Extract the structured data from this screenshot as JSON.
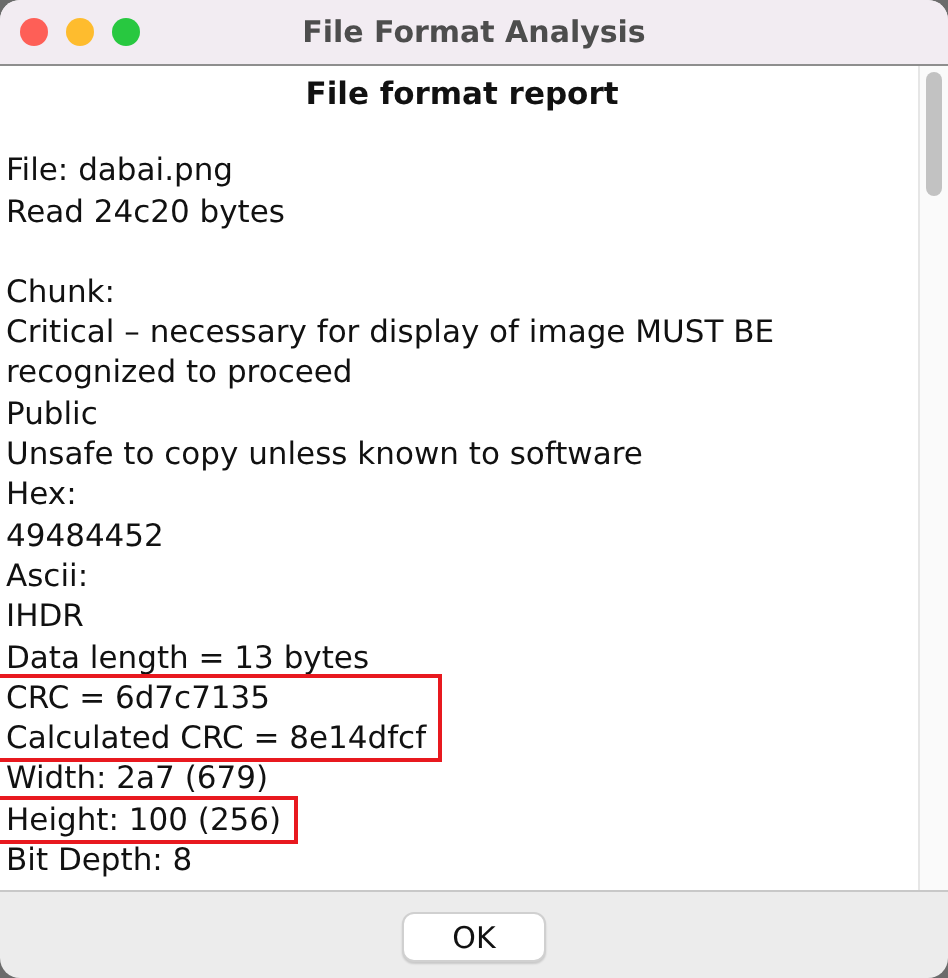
{
  "window": {
    "title": "File Format Analysis"
  },
  "report": {
    "heading": "File format report",
    "sections": [
      [
        {
          "kind": "line",
          "text": "File: dabai.png"
        },
        {
          "kind": "line",
          "text": "Read 24c20 bytes"
        }
      ],
      [
        {
          "kind": "line",
          "text": "Chunk:"
        },
        {
          "kind": "line",
          "text": "Critical – necessary for display of image MUST BE recognized to proceed"
        },
        {
          "kind": "line",
          "text": "Public"
        },
        {
          "kind": "line",
          "text": "Unsafe to copy unless known to software"
        },
        {
          "kind": "line",
          "text": "Hex:"
        },
        {
          "kind": "line",
          "text": "49484452"
        },
        {
          "kind": "line",
          "text": "Ascii:"
        },
        {
          "kind": "line",
          "text": "IHDR"
        },
        {
          "kind": "line",
          "text": "Data length = 13 bytes"
        },
        {
          "kind": "highlight",
          "lines": [
            "CRC = 6d7c7135",
            "Calculated CRC = 8e14dfcf"
          ]
        },
        {
          "kind": "line",
          "text": "Width: 2a7 (679)"
        },
        {
          "kind": "highlight",
          "lines": [
            "Height: 100 (256)"
          ]
        },
        {
          "kind": "line",
          "text": "Bit Depth: 8"
        }
      ]
    ]
  },
  "buttons": [
    {
      "label": "OK"
    }
  ]
}
